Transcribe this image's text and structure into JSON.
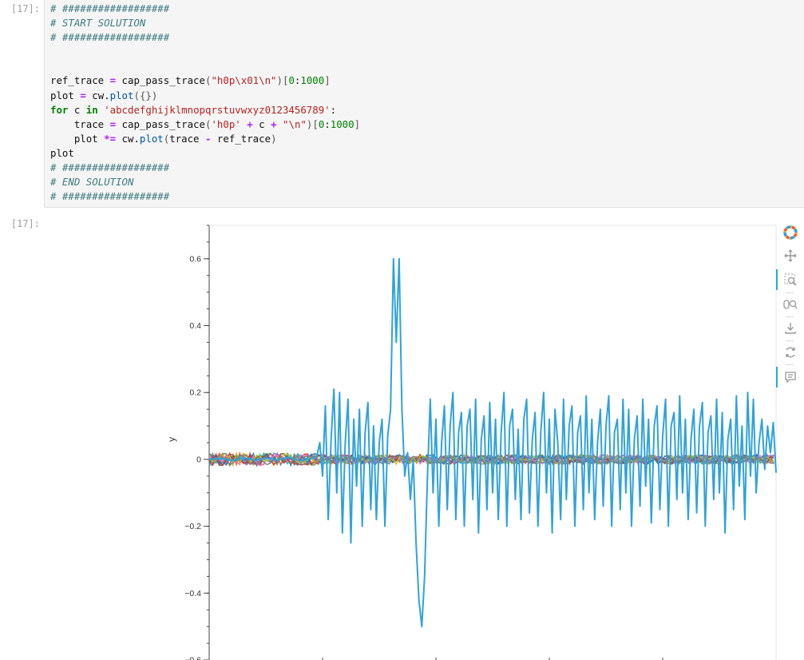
{
  "notebook": {
    "input_prompt": "[17]:",
    "output_prompt": "[17]:"
  },
  "code_lines": [
    "# ##################",
    "# START SOLUTION",
    "# ##################",
    "",
    "",
    "ref_trace = cap_pass_trace(\"h0p\\x01\\n\")[0:1000]",
    "plot = cw.plot({})",
    "for c in 'abcdefghijklmnopqrstuvwxyz0123456789':",
    "    trace = cap_pass_trace('h0p' + c + \"\\n\")[0:1000]",
    "    plot *= cw.plot(trace - ref_trace)",
    "plot",
    "# ##################",
    "# END SOLUTION",
    "# ##################"
  ],
  "chart_data": {
    "type": "line",
    "title": "",
    "xlabel": "",
    "ylabel": "y",
    "ylim": [
      -0.6,
      0.7
    ],
    "yticks": [
      {
        "value": 0.6,
        "label": "0.6"
      },
      {
        "value": 0.4,
        "label": "0.4"
      },
      {
        "value": 0.2,
        "label": "0.2"
      },
      {
        "value": 0,
        "label": "0"
      },
      {
        "value": -0.2,
        "label": "−0.2"
      },
      {
        "value": -0.4,
        "label": "−0.4"
      },
      {
        "value": -0.6,
        "label": "−0.6"
      }
    ],
    "xlim": [
      0,
      1000
    ],
    "xticks_minor": [
      200,
      400,
      600,
      800
    ],
    "grid": false,
    "legend": "none",
    "highlight_series": {
      "color": "#30a2da",
      "x": [
        0,
        20,
        40,
        60,
        80,
        100,
        120,
        140,
        160,
        180,
        190,
        195,
        200,
        205,
        210,
        215,
        220,
        225,
        230,
        235,
        240,
        245,
        250,
        255,
        260,
        265,
        270,
        275,
        280,
        285,
        290,
        295,
        300,
        305,
        310,
        315,
        320,
        325,
        330,
        335,
        340,
        345,
        350,
        355,
        360,
        365,
        370,
        375,
        380,
        385,
        390,
        395,
        400,
        405,
        410,
        415,
        420,
        425,
        430,
        435,
        440,
        445,
        450,
        455,
        460,
        465,
        470,
        475,
        480,
        485,
        490,
        495,
        500,
        505,
        510,
        515,
        520,
        525,
        530,
        535,
        540,
        545,
        550,
        555,
        560,
        565,
        570,
        575,
        580,
        585,
        590,
        595,
        600,
        605,
        610,
        615,
        620,
        625,
        630,
        635,
        640,
        645,
        650,
        655,
        660,
        665,
        670,
        675,
        680,
        685,
        690,
        695,
        700,
        705,
        710,
        715,
        720,
        725,
        730,
        735,
        740,
        745,
        750,
        755,
        760,
        765,
        770,
        775,
        780,
        785,
        790,
        795,
        800,
        805,
        810,
        815,
        820,
        825,
        830,
        835,
        840,
        845,
        850,
        855,
        860,
        865,
        870,
        875,
        880,
        885,
        890,
        895,
        900,
        905,
        910,
        915,
        920,
        925,
        930,
        935,
        940,
        945,
        950,
        955,
        960,
        965,
        970,
        975,
        980,
        985,
        990,
        995,
        1000
      ],
      "y": [
        0,
        0.003,
        -0.004,
        0.005,
        -0.003,
        0.004,
        -0.002,
        0.006,
        -0.004,
        0.002,
        0.01,
        0.05,
        -0.05,
        0.16,
        -0.18,
        0.06,
        0.21,
        -0.1,
        0.2,
        -0.22,
        0.05,
        0.18,
        -0.25,
        0.12,
        -0.08,
        0.15,
        -0.2,
        0.08,
        0.17,
        -0.15,
        0.1,
        -0.18,
        0.05,
        0.12,
        -0.2,
        0.07,
        0.15,
        0.6,
        0.35,
        0.6,
        0.15,
        -0.05,
        0.02,
        -0.12,
        0.0,
        -0.25,
        -0.42,
        -0.5,
        -0.35,
        -0.05,
        0.18,
        -0.1,
        0.12,
        -0.2,
        0.05,
        0.16,
        -0.15,
        0.1,
        0.2,
        -0.18,
        0.08,
        0.14,
        -0.2,
        0.1,
        0.15,
        -0.12,
        0.18,
        -0.22,
        0.06,
        0.13,
        -0.15,
        0.17,
        -0.1,
        0.12,
        -0.18,
        0.08,
        0.2,
        -0.2,
        0.1,
        0.15,
        -0.12,
        0.09,
        -0.18,
        0.12,
        0.18,
        -0.16,
        0.06,
        0.14,
        -0.2,
        0.08,
        0.2,
        -0.1,
        0.12,
        -0.22,
        0.15,
        0.05,
        -0.18,
        0.18,
        -0.12,
        0.1,
        0.16,
        -0.2,
        0.08,
        0.13,
        -0.15,
        0.19,
        -0.1,
        0.12,
        -0.18,
        0.05,
        0.15,
        -0.14,
        0.1,
        0.19,
        -0.2,
        0.08,
        0.12,
        -0.15,
        0.18,
        -0.1,
        0.15,
        -0.2,
        0.06,
        0.13,
        -0.14,
        0.18,
        -0.08,
        0.12,
        -0.19,
        0.1,
        0.16,
        -0.15,
        0.07,
        0.18,
        -0.2,
        0.1,
        0.14,
        -0.12,
        0.19,
        -0.1,
        0.12,
        -0.18,
        0.06,
        0.15,
        -0.16,
        0.1,
        0.17,
        -0.2,
        0.08,
        0.13,
        -0.12,
        0.18,
        -0.1,
        0.14,
        -0.22,
        0.06,
        0.12,
        -0.15,
        0.19,
        -0.08,
        0.1,
        -0.18,
        0.2,
        -0.05,
        0.18,
        -0.1,
        0.05,
        0.12,
        -0.03,
        0.1,
        0.02,
        0.11,
        -0.04,
        0.12,
        0.05,
        0.1,
        0.01,
        0.08
      ]
    },
    "noise_series_colors": [
      "#fc4f30",
      "#e5ae38",
      "#6d904f",
      "#8b8b8b",
      "#17becf",
      "#9467bd",
      "#d62728",
      "#1f77b4",
      "#e377c2",
      "#8c564b",
      "#bcbd22",
      "#7f7f7f"
    ]
  },
  "toolbar": {
    "icons": [
      "bokeh-logo-icon",
      "pan-icon",
      "box-zoom-icon",
      "wheel-zoom-icon",
      "save-icon",
      "reset-icon",
      "hover-icon"
    ]
  }
}
